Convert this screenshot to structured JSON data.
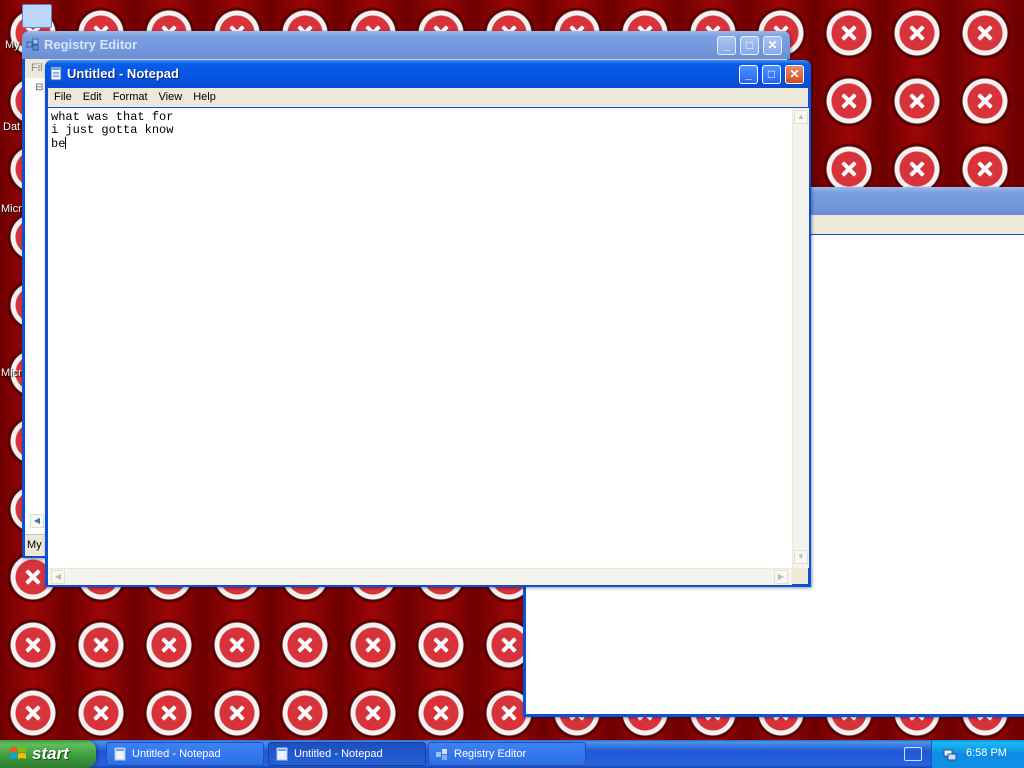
{
  "desktop": {
    "icon_labels": [
      "My",
      "Dat",
      "Micr",
      "Micr"
    ]
  },
  "registry_editor": {
    "title": "Registry Editor",
    "menu_fragment": "Fil",
    "status_fragment": "My",
    "tree_expander": "⊟"
  },
  "notepad": {
    "title": "Untitled - Notepad",
    "menus": [
      "File",
      "Edit",
      "Format",
      "View",
      "Help"
    ],
    "text_lines": [
      "what was that for",
      "i just gotta know",
      "be"
    ]
  },
  "taskbar": {
    "start_label": "start",
    "tasks": [
      {
        "label": "Untitled - Notepad"
      },
      {
        "label": "Untitled - Notepad"
      },
      {
        "label": "Registry Editor"
      }
    ],
    "clock": "6:58 PM"
  },
  "colors": {
    "xp_blue": "#0a50d8",
    "wallpaper_red": "#8a0000",
    "start_green": "#3c9a3c",
    "tray_blue": "#1290e9"
  }
}
